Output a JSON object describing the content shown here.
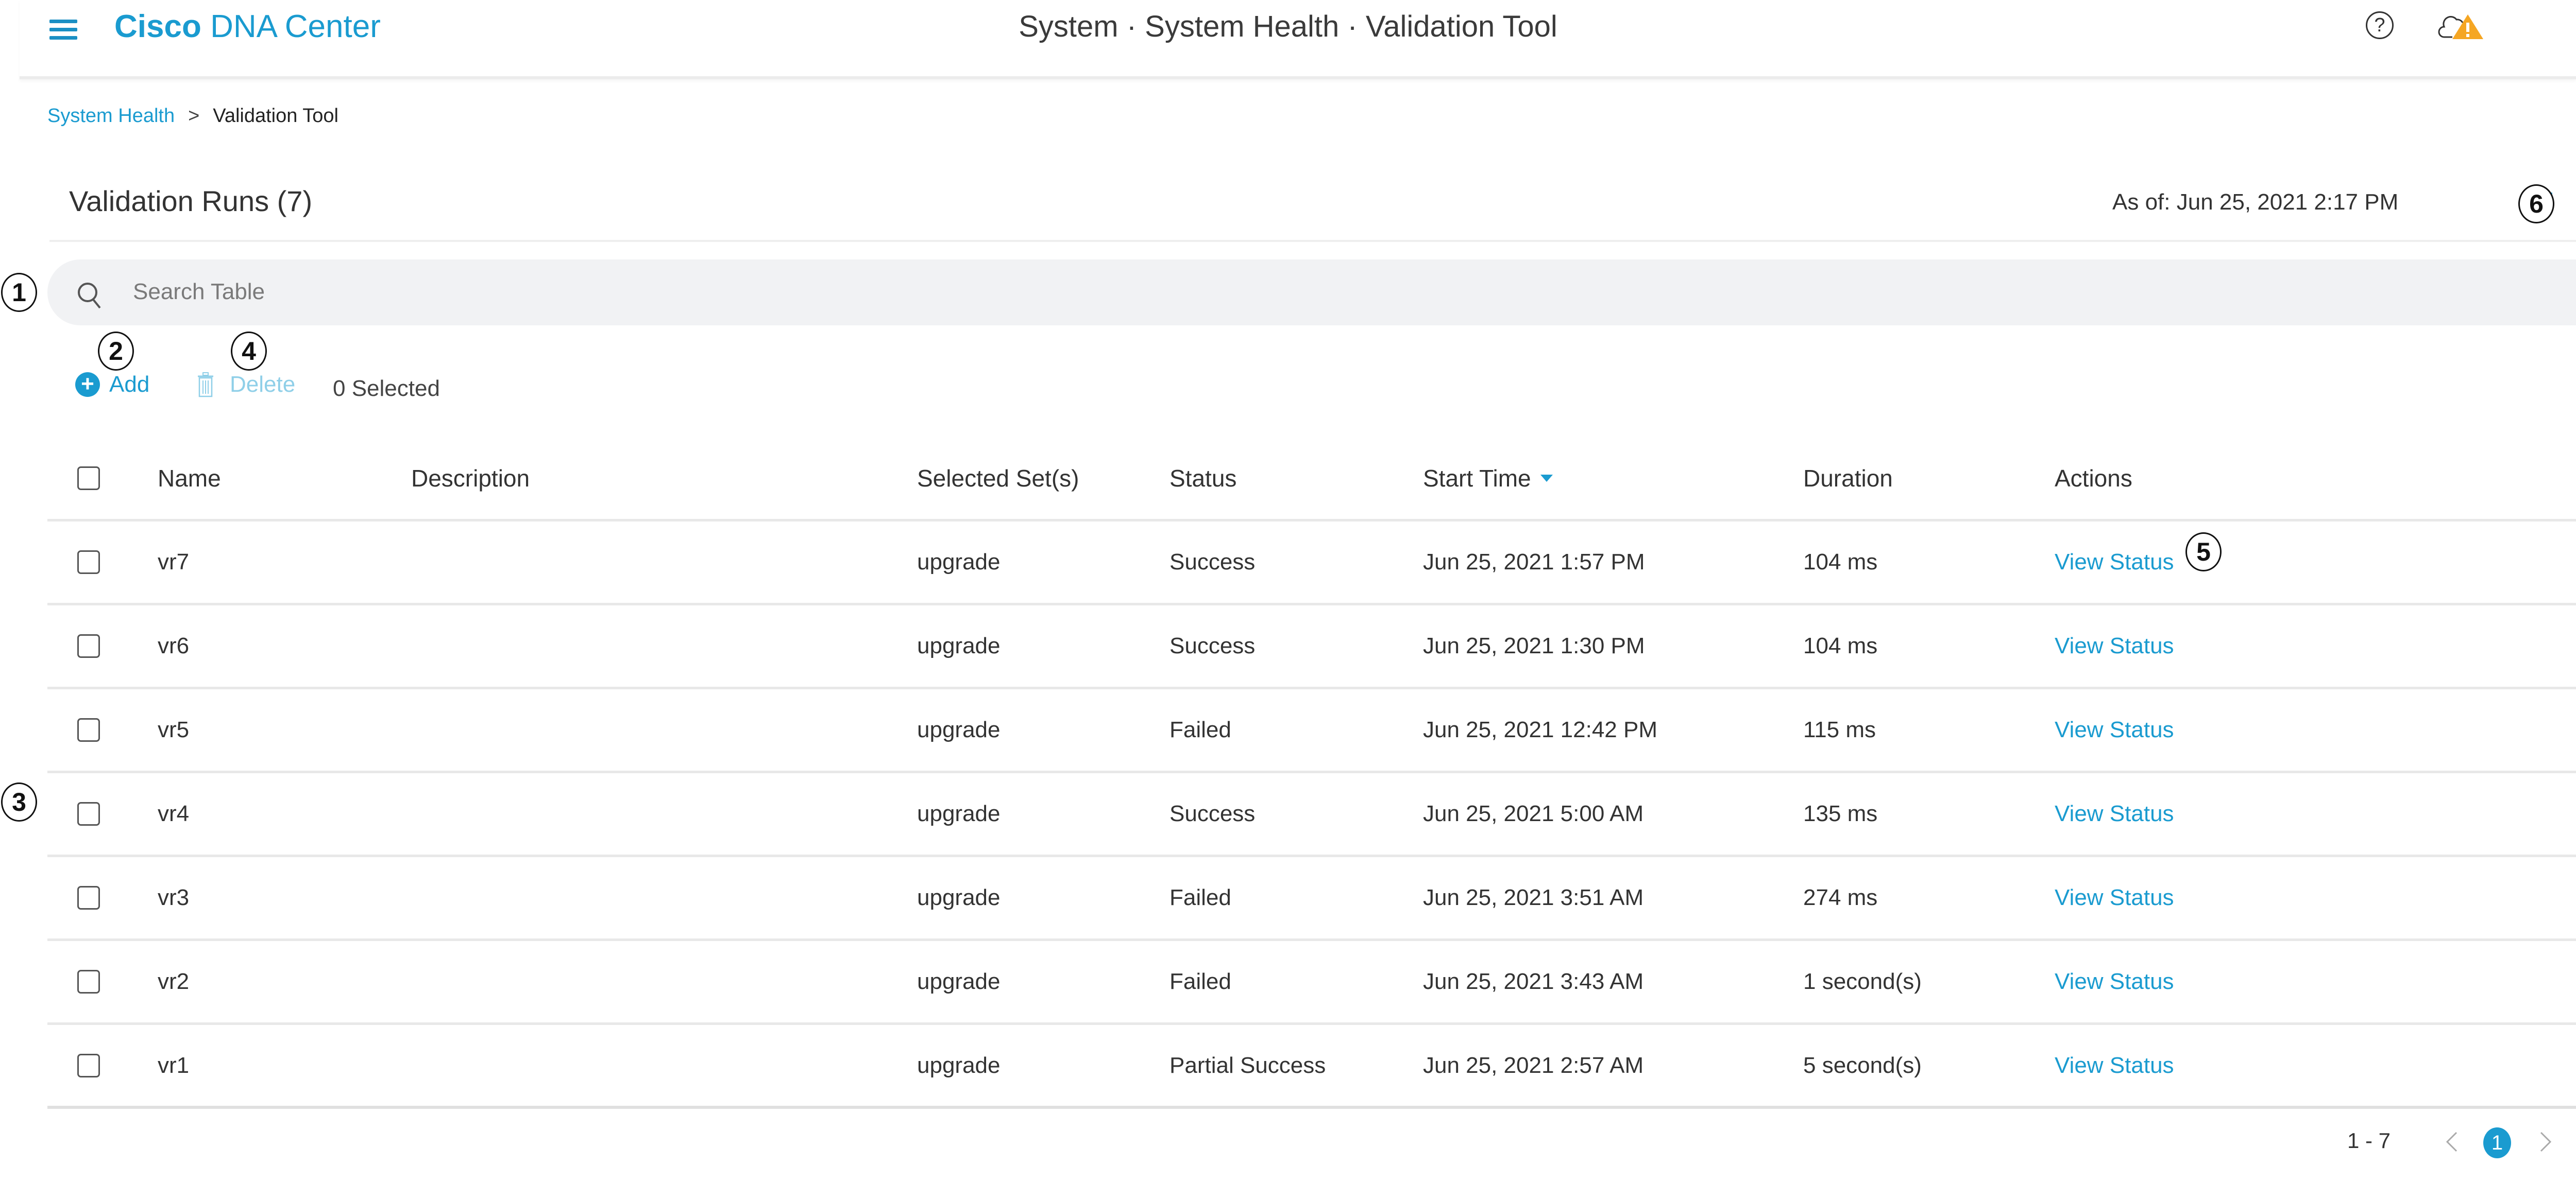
{
  "header": {
    "brand_bold": "Cisco",
    "brand_light": " DNA Center",
    "page_title": "System · System Health · Validation Tool",
    "help_label": "?"
  },
  "breadcrumb": {
    "parent": "System Health",
    "separator": ">",
    "current": "Validation Tool"
  },
  "section": {
    "title": "Validation Runs (7)",
    "as_of": "As of: Jun 25, 2021 2:17 PM"
  },
  "search": {
    "placeholder": "Search Table",
    "value": ""
  },
  "toolbar": {
    "add_label": "Add",
    "add_icon": "+",
    "delete_label": "Delete",
    "selected_label": "0 Selected"
  },
  "callouts": [
    "1",
    "2",
    "3",
    "4",
    "5",
    "6"
  ],
  "table": {
    "columns": [
      "Name",
      "Description",
      "Selected Set(s)",
      "Status",
      "Start Time",
      "Duration",
      "Actions"
    ],
    "sorted_column": "Start Time",
    "rows": [
      {
        "name": "vr7",
        "description": "",
        "set": "upgrade",
        "status": "Success",
        "start": "Jun 25, 2021 1:57 PM",
        "duration": "104 ms",
        "action": "View Status"
      },
      {
        "name": "vr6",
        "description": "",
        "set": "upgrade",
        "status": "Success",
        "start": "Jun 25, 2021 1:30 PM",
        "duration": "104 ms",
        "action": "View Status"
      },
      {
        "name": "vr5",
        "description": "",
        "set": "upgrade",
        "status": "Failed",
        "start": "Jun 25, 2021 12:42 PM",
        "duration": "115 ms",
        "action": "View Status"
      },
      {
        "name": "vr4",
        "description": "",
        "set": "upgrade",
        "status": "Success",
        "start": "Jun 25, 2021 5:00 AM",
        "duration": "135 ms",
        "action": "View Status"
      },
      {
        "name": "vr3",
        "description": "",
        "set": "upgrade",
        "status": "Failed",
        "start": "Jun 25, 2021 3:51 AM",
        "duration": "274 ms",
        "action": "View Status"
      },
      {
        "name": "vr2",
        "description": "",
        "set": "upgrade",
        "status": "Failed",
        "start": "Jun 25, 2021 3:43 AM",
        "duration": "1 second(s)",
        "action": "View Status"
      },
      {
        "name": "vr1",
        "description": "",
        "set": "upgrade",
        "status": "Partial Success",
        "start": "Jun 25, 2021 2:57 AM",
        "duration": "5 second(s)",
        "action": "View Status"
      }
    ]
  },
  "pagination": {
    "range": "1 - 7",
    "current_page": "1"
  },
  "colors": {
    "accent": "#1a9bd0",
    "warning": "#f5a623",
    "disabled_accent": "#8fcfe8"
  }
}
